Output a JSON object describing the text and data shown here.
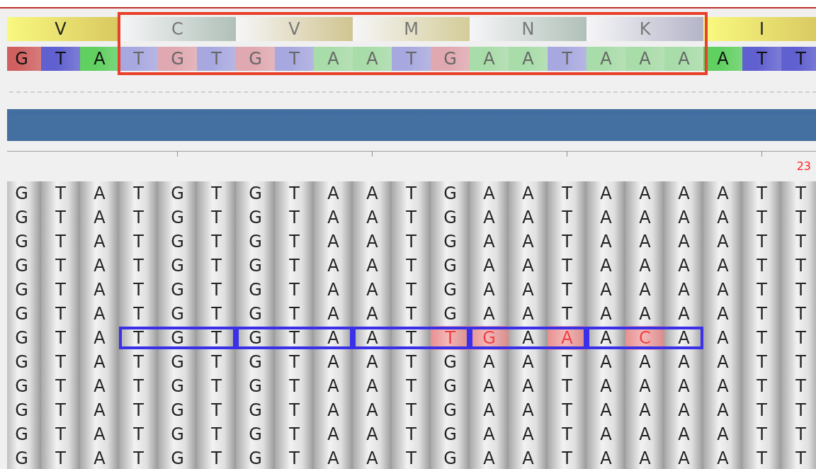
{
  "reference": {
    "codons": [
      {
        "aa": "V",
        "selected": false,
        "color": "#d8c860"
      },
      {
        "aa": "C",
        "selected": true,
        "color": "#b0c0b8"
      },
      {
        "aa": "V",
        "selected": true,
        "color": "#d0c490"
      },
      {
        "aa": "M",
        "selected": true,
        "color": "#d4cc98"
      },
      {
        "aa": "N",
        "selected": true,
        "color": "#b0c0b8"
      },
      {
        "aa": "K",
        "selected": true,
        "color": "#b4b4c8"
      },
      {
        "aa": "I",
        "selected": false,
        "color": "#d8c860"
      }
    ],
    "bases": [
      {
        "base": "G",
        "selected": false,
        "color": "#d06060"
      },
      {
        "base": "T",
        "selected": false,
        "color": "#6060d0"
      },
      {
        "base": "A",
        "selected": false,
        "color": "#60d060"
      },
      {
        "base": "T",
        "selected": true,
        "color": "#a8a8e0"
      },
      {
        "base": "G",
        "selected": true,
        "color": "#e0a8b0"
      },
      {
        "base": "T",
        "selected": true,
        "color": "#a8a8e0"
      },
      {
        "base": "G",
        "selected": true,
        "color": "#e0a8b0"
      },
      {
        "base": "T",
        "selected": true,
        "color": "#a8a8e0"
      },
      {
        "base": "A",
        "selected": true,
        "color": "#a8dca8"
      },
      {
        "base": "A",
        "selected": true,
        "color": "#a8dca8"
      },
      {
        "base": "T",
        "selected": true,
        "color": "#a8a8e0"
      },
      {
        "base": "G",
        "selected": true,
        "color": "#e0a8b0"
      },
      {
        "base": "A",
        "selected": true,
        "color": "#a8dca8"
      },
      {
        "base": "A",
        "selected": true,
        "color": "#a8dca8"
      },
      {
        "base": "T",
        "selected": true,
        "color": "#a8a8e0"
      },
      {
        "base": "A",
        "selected": true,
        "color": "#a8dca8"
      },
      {
        "base": "A",
        "selected": true,
        "color": "#a8dca8"
      },
      {
        "base": "A",
        "selected": true,
        "color": "#a8dca8"
      },
      {
        "base": "A",
        "selected": false,
        "color": "#60d060"
      },
      {
        "base": "T",
        "selected": false,
        "color": "#6060d0"
      },
      {
        "base": "T",
        "selected": false,
        "color": "#6060d0"
      }
    ]
  },
  "ruler": {
    "label": "23"
  },
  "reads": [
    {
      "boxed": false,
      "bases": [
        {
          "b": "G",
          "mismatch": false
        },
        {
          "b": "T",
          "mismatch": false
        },
        {
          "b": "A",
          "mismatch": false
        },
        {
          "b": "T",
          "mismatch": false
        },
        {
          "b": "G",
          "mismatch": false
        },
        {
          "b": "T",
          "mismatch": false
        },
        {
          "b": "G",
          "mismatch": false
        },
        {
          "b": "T",
          "mismatch": false
        },
        {
          "b": "A",
          "mismatch": false
        },
        {
          "b": "A",
          "mismatch": false
        },
        {
          "b": "T",
          "mismatch": false
        },
        {
          "b": "G",
          "mismatch": false
        },
        {
          "b": "A",
          "mismatch": false
        },
        {
          "b": "A",
          "mismatch": false
        },
        {
          "b": "T",
          "mismatch": false
        },
        {
          "b": "A",
          "mismatch": false
        },
        {
          "b": "A",
          "mismatch": false
        },
        {
          "b": "A",
          "mismatch": false
        },
        {
          "b": "A",
          "mismatch": false
        },
        {
          "b": "T",
          "mismatch": false
        },
        {
          "b": "T",
          "mismatch": false
        }
      ]
    },
    {
      "boxed": false,
      "bases": [
        {
          "b": "G",
          "mismatch": false
        },
        {
          "b": "T",
          "mismatch": false
        },
        {
          "b": "A",
          "mismatch": false
        },
        {
          "b": "T",
          "mismatch": false
        },
        {
          "b": "G",
          "mismatch": false
        },
        {
          "b": "T",
          "mismatch": false
        },
        {
          "b": "G",
          "mismatch": false
        },
        {
          "b": "T",
          "mismatch": false
        },
        {
          "b": "A",
          "mismatch": false
        },
        {
          "b": "A",
          "mismatch": false
        },
        {
          "b": "T",
          "mismatch": false
        },
        {
          "b": "G",
          "mismatch": false
        },
        {
          "b": "A",
          "mismatch": false
        },
        {
          "b": "A",
          "mismatch": false
        },
        {
          "b": "T",
          "mismatch": false
        },
        {
          "b": "A",
          "mismatch": false
        },
        {
          "b": "A",
          "mismatch": false
        },
        {
          "b": "A",
          "mismatch": false
        },
        {
          "b": "A",
          "mismatch": false
        },
        {
          "b": "T",
          "mismatch": false
        },
        {
          "b": "T",
          "mismatch": false
        }
      ]
    },
    {
      "boxed": false,
      "bases": [
        {
          "b": "G",
          "mismatch": false
        },
        {
          "b": "T",
          "mismatch": false
        },
        {
          "b": "A",
          "mismatch": false
        },
        {
          "b": "T",
          "mismatch": false
        },
        {
          "b": "G",
          "mismatch": false
        },
        {
          "b": "T",
          "mismatch": false
        },
        {
          "b": "G",
          "mismatch": false
        },
        {
          "b": "T",
          "mismatch": false
        },
        {
          "b": "A",
          "mismatch": false
        },
        {
          "b": "A",
          "mismatch": false
        },
        {
          "b": "T",
          "mismatch": false
        },
        {
          "b": "G",
          "mismatch": false
        },
        {
          "b": "A",
          "mismatch": false
        },
        {
          "b": "A",
          "mismatch": false
        },
        {
          "b": "T",
          "mismatch": false
        },
        {
          "b": "A",
          "mismatch": false
        },
        {
          "b": "A",
          "mismatch": false
        },
        {
          "b": "A",
          "mismatch": false
        },
        {
          "b": "A",
          "mismatch": false
        },
        {
          "b": "T",
          "mismatch": false
        },
        {
          "b": "T",
          "mismatch": false
        }
      ]
    },
    {
      "boxed": false,
      "bases": [
        {
          "b": "G",
          "mismatch": false
        },
        {
          "b": "T",
          "mismatch": false
        },
        {
          "b": "A",
          "mismatch": false
        },
        {
          "b": "T",
          "mismatch": false
        },
        {
          "b": "G",
          "mismatch": false
        },
        {
          "b": "T",
          "mismatch": false
        },
        {
          "b": "G",
          "mismatch": false
        },
        {
          "b": "T",
          "mismatch": false
        },
        {
          "b": "A",
          "mismatch": false
        },
        {
          "b": "A",
          "mismatch": false
        },
        {
          "b": "T",
          "mismatch": false
        },
        {
          "b": "G",
          "mismatch": false
        },
        {
          "b": "A",
          "mismatch": false
        },
        {
          "b": "A",
          "mismatch": false
        },
        {
          "b": "T",
          "mismatch": false
        },
        {
          "b": "A",
          "mismatch": false
        },
        {
          "b": "A",
          "mismatch": false
        },
        {
          "b": "A",
          "mismatch": false
        },
        {
          "b": "A",
          "mismatch": false
        },
        {
          "b": "T",
          "mismatch": false
        },
        {
          "b": "T",
          "mismatch": false
        }
      ]
    },
    {
      "boxed": false,
      "bases": [
        {
          "b": "G",
          "mismatch": false
        },
        {
          "b": "T",
          "mismatch": false
        },
        {
          "b": "A",
          "mismatch": false
        },
        {
          "b": "T",
          "mismatch": false
        },
        {
          "b": "G",
          "mismatch": false
        },
        {
          "b": "T",
          "mismatch": false
        },
        {
          "b": "G",
          "mismatch": false
        },
        {
          "b": "T",
          "mismatch": false
        },
        {
          "b": "A",
          "mismatch": false
        },
        {
          "b": "A",
          "mismatch": false
        },
        {
          "b": "T",
          "mismatch": false
        },
        {
          "b": "G",
          "mismatch": false
        },
        {
          "b": "A",
          "mismatch": false
        },
        {
          "b": "A",
          "mismatch": false
        },
        {
          "b": "T",
          "mismatch": false
        },
        {
          "b": "A",
          "mismatch": false
        },
        {
          "b": "A",
          "mismatch": false
        },
        {
          "b": "A",
          "mismatch": false
        },
        {
          "b": "A",
          "mismatch": false
        },
        {
          "b": "T",
          "mismatch": false
        },
        {
          "b": "T",
          "mismatch": false
        }
      ]
    },
    {
      "boxed": false,
      "bases": [
        {
          "b": "G",
          "mismatch": false
        },
        {
          "b": "T",
          "mismatch": false
        },
        {
          "b": "A",
          "mismatch": false
        },
        {
          "b": "T",
          "mismatch": false
        },
        {
          "b": "G",
          "mismatch": false
        },
        {
          "b": "T",
          "mismatch": false
        },
        {
          "b": "G",
          "mismatch": false
        },
        {
          "b": "T",
          "mismatch": false
        },
        {
          "b": "A",
          "mismatch": false
        },
        {
          "b": "A",
          "mismatch": false
        },
        {
          "b": "T",
          "mismatch": false
        },
        {
          "b": "G",
          "mismatch": false
        },
        {
          "b": "A",
          "mismatch": false
        },
        {
          "b": "A",
          "mismatch": false
        },
        {
          "b": "T",
          "mismatch": false
        },
        {
          "b": "A",
          "mismatch": false
        },
        {
          "b": "A",
          "mismatch": false
        },
        {
          "b": "A",
          "mismatch": false
        },
        {
          "b": "A",
          "mismatch": false
        },
        {
          "b": "T",
          "mismatch": false
        },
        {
          "b": "T",
          "mismatch": false
        }
      ]
    },
    {
      "boxed": true,
      "bases": [
        {
          "b": "G",
          "mismatch": false
        },
        {
          "b": "T",
          "mismatch": false
        },
        {
          "b": "A",
          "mismatch": false
        },
        {
          "b": "T",
          "mismatch": false
        },
        {
          "b": "G",
          "mismatch": false
        },
        {
          "b": "T",
          "mismatch": false
        },
        {
          "b": "G",
          "mismatch": false
        },
        {
          "b": "T",
          "mismatch": false
        },
        {
          "b": "A",
          "mismatch": false
        },
        {
          "b": "A",
          "mismatch": false
        },
        {
          "b": "T",
          "mismatch": false
        },
        {
          "b": "T",
          "mismatch": true
        },
        {
          "b": "G",
          "mismatch": true
        },
        {
          "b": "A",
          "mismatch": false
        },
        {
          "b": "A",
          "mismatch": true
        },
        {
          "b": "A",
          "mismatch": false
        },
        {
          "b": "C",
          "mismatch": true
        },
        {
          "b": "A",
          "mismatch": false
        },
        {
          "b": "A",
          "mismatch": false
        },
        {
          "b": "T",
          "mismatch": false
        },
        {
          "b": "T",
          "mismatch": false
        }
      ]
    },
    {
      "boxed": false,
      "bases": [
        {
          "b": "G",
          "mismatch": false
        },
        {
          "b": "T",
          "mismatch": false
        },
        {
          "b": "A",
          "mismatch": false
        },
        {
          "b": "T",
          "mismatch": false
        },
        {
          "b": "G",
          "mismatch": false
        },
        {
          "b": "T",
          "mismatch": false
        },
        {
          "b": "G",
          "mismatch": false
        },
        {
          "b": "T",
          "mismatch": false
        },
        {
          "b": "A",
          "mismatch": false
        },
        {
          "b": "A",
          "mismatch": false
        },
        {
          "b": "T",
          "mismatch": false
        },
        {
          "b": "G",
          "mismatch": false
        },
        {
          "b": "A",
          "mismatch": false
        },
        {
          "b": "A",
          "mismatch": false
        },
        {
          "b": "T",
          "mismatch": false
        },
        {
          "b": "A",
          "mismatch": false
        },
        {
          "b": "A",
          "mismatch": false
        },
        {
          "b": "A",
          "mismatch": false
        },
        {
          "b": "A",
          "mismatch": false
        },
        {
          "b": "T",
          "mismatch": false
        },
        {
          "b": "T",
          "mismatch": false
        }
      ]
    },
    {
      "boxed": false,
      "bases": [
        {
          "b": "G",
          "mismatch": false
        },
        {
          "b": "T",
          "mismatch": false
        },
        {
          "b": "A",
          "mismatch": false
        },
        {
          "b": "T",
          "mismatch": false
        },
        {
          "b": "G",
          "mismatch": false
        },
        {
          "b": "T",
          "mismatch": false
        },
        {
          "b": "G",
          "mismatch": false
        },
        {
          "b": "T",
          "mismatch": false
        },
        {
          "b": "A",
          "mismatch": false
        },
        {
          "b": "A",
          "mismatch": false
        },
        {
          "b": "T",
          "mismatch": false
        },
        {
          "b": "G",
          "mismatch": false
        },
        {
          "b": "A",
          "mismatch": false
        },
        {
          "b": "A",
          "mismatch": false
        },
        {
          "b": "T",
          "mismatch": false
        },
        {
          "b": "A",
          "mismatch": false
        },
        {
          "b": "A",
          "mismatch": false
        },
        {
          "b": "A",
          "mismatch": false
        },
        {
          "b": "A",
          "mismatch": false
        },
        {
          "b": "T",
          "mismatch": false
        },
        {
          "b": "T",
          "mismatch": false
        }
      ]
    },
    {
      "boxed": false,
      "bases": [
        {
          "b": "G",
          "mismatch": false
        },
        {
          "b": "T",
          "mismatch": false
        },
        {
          "b": "A",
          "mismatch": false
        },
        {
          "b": "T",
          "mismatch": false
        },
        {
          "b": "G",
          "mismatch": false
        },
        {
          "b": "T",
          "mismatch": false
        },
        {
          "b": "G",
          "mismatch": false
        },
        {
          "b": "T",
          "mismatch": false
        },
        {
          "b": "A",
          "mismatch": false
        },
        {
          "b": "A",
          "mismatch": false
        },
        {
          "b": "T",
          "mismatch": false
        },
        {
          "b": "G",
          "mismatch": false
        },
        {
          "b": "A",
          "mismatch": false
        },
        {
          "b": "A",
          "mismatch": false
        },
        {
          "b": "T",
          "mismatch": false
        },
        {
          "b": "A",
          "mismatch": false
        },
        {
          "b": "A",
          "mismatch": false
        },
        {
          "b": "A",
          "mismatch": false
        },
        {
          "b": "A",
          "mismatch": false
        },
        {
          "b": "T",
          "mismatch": false
        },
        {
          "b": "T",
          "mismatch": false
        }
      ]
    },
    {
      "boxed": false,
      "bases": [
        {
          "b": "G",
          "mismatch": false
        },
        {
          "b": "T",
          "mismatch": false
        },
        {
          "b": "A",
          "mismatch": false
        },
        {
          "b": "T",
          "mismatch": false
        },
        {
          "b": "G",
          "mismatch": false
        },
        {
          "b": "T",
          "mismatch": false
        },
        {
          "b": "G",
          "mismatch": false
        },
        {
          "b": "T",
          "mismatch": false
        },
        {
          "b": "A",
          "mismatch": false
        },
        {
          "b": "A",
          "mismatch": false
        },
        {
          "b": "T",
          "mismatch": false
        },
        {
          "b": "G",
          "mismatch": false
        },
        {
          "b": "A",
          "mismatch": false
        },
        {
          "b": "A",
          "mismatch": false
        },
        {
          "b": "T",
          "mismatch": false
        },
        {
          "b": "A",
          "mismatch": false
        },
        {
          "b": "A",
          "mismatch": false
        },
        {
          "b": "A",
          "mismatch": false
        },
        {
          "b": "A",
          "mismatch": false
        },
        {
          "b": "T",
          "mismatch": false
        },
        {
          "b": "T",
          "mismatch": false
        }
      ]
    },
    {
      "boxed": false,
      "bases": [
        {
          "b": "G",
          "mismatch": false
        },
        {
          "b": "T",
          "mismatch": false
        },
        {
          "b": "A",
          "mismatch": false
        },
        {
          "b": "T",
          "mismatch": false
        },
        {
          "b": "G",
          "mismatch": false
        },
        {
          "b": "T",
          "mismatch": false
        },
        {
          "b": "G",
          "mismatch": false
        },
        {
          "b": "T",
          "mismatch": false
        },
        {
          "b": "A",
          "mismatch": false
        },
        {
          "b": "A",
          "mismatch": false
        },
        {
          "b": "T",
          "mismatch": false
        },
        {
          "b": "G",
          "mismatch": false
        },
        {
          "b": "A",
          "mismatch": false
        },
        {
          "b": "A",
          "mismatch": false
        },
        {
          "b": "T",
          "mismatch": false
        },
        {
          "b": "A",
          "mismatch": false
        },
        {
          "b": "A",
          "mismatch": false
        },
        {
          "b": "A",
          "mismatch": false
        },
        {
          "b": "A",
          "mismatch": false
        },
        {
          "b": "T",
          "mismatch": false
        },
        {
          "b": "T",
          "mismatch": false
        }
      ]
    }
  ]
}
